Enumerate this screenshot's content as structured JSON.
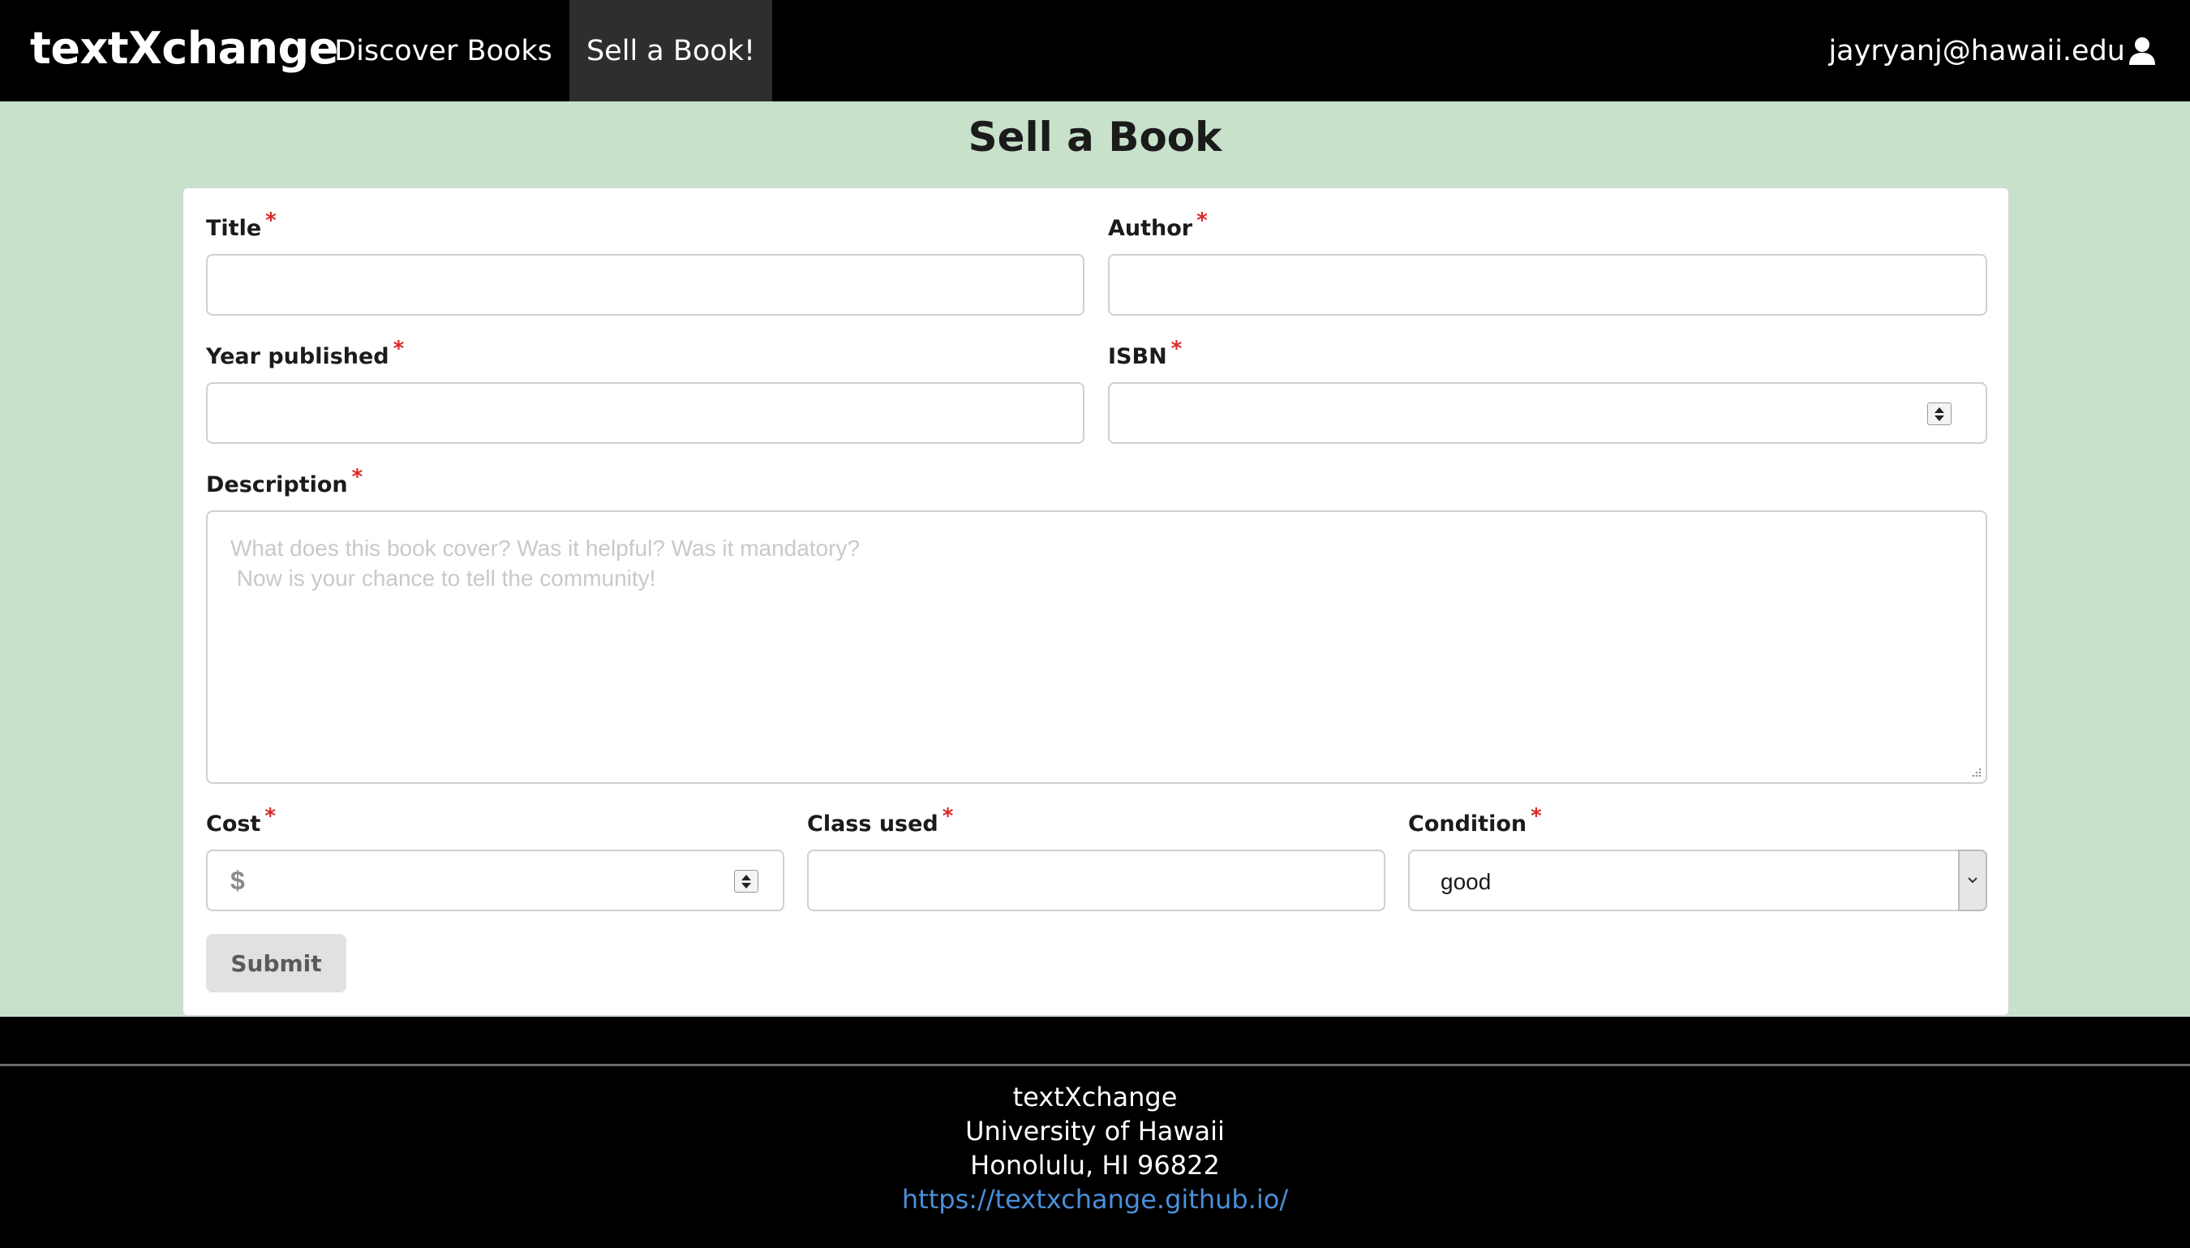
{
  "nav": {
    "brand": "textXchange",
    "items": [
      {
        "label": "Discover Books"
      },
      {
        "label": "Sell a Book!"
      }
    ],
    "user_email": "jayryanj@hawaii.edu"
  },
  "page": {
    "title": "Sell a Book"
  },
  "form": {
    "required_marker": "*",
    "title": {
      "label": "Title",
      "value": ""
    },
    "author": {
      "label": "Author",
      "value": ""
    },
    "year": {
      "label": "Year published",
      "value": ""
    },
    "isbn": {
      "label": "ISBN",
      "value": ""
    },
    "description": {
      "label": "Description",
      "placeholder": "What does this book cover? Was it helpful? Was it mandatory?\n Now is your chance to tell the community!",
      "value": ""
    },
    "cost": {
      "label": "Cost",
      "prefix": "$",
      "value": ""
    },
    "class_used": {
      "label": "Class used",
      "value": ""
    },
    "condition": {
      "label": "Condition",
      "selected": "good"
    },
    "submit_label": "Submit"
  },
  "footer": {
    "lines": [
      "textXchange",
      "University of Hawaii",
      "Honolulu, HI 96822"
    ],
    "link": "https://textxchange.github.io/"
  },
  "colors": {
    "page_bg": "#c8e1cb",
    "nav_bg": "#000000",
    "nav_active_bg": "#2e2e2e",
    "required": "#db2828",
    "link": "#4a8fd9"
  },
  "icons": {
    "user": "user-icon",
    "spinner": "number-spinner-icon",
    "dropdown": "chevron-down-icon"
  }
}
